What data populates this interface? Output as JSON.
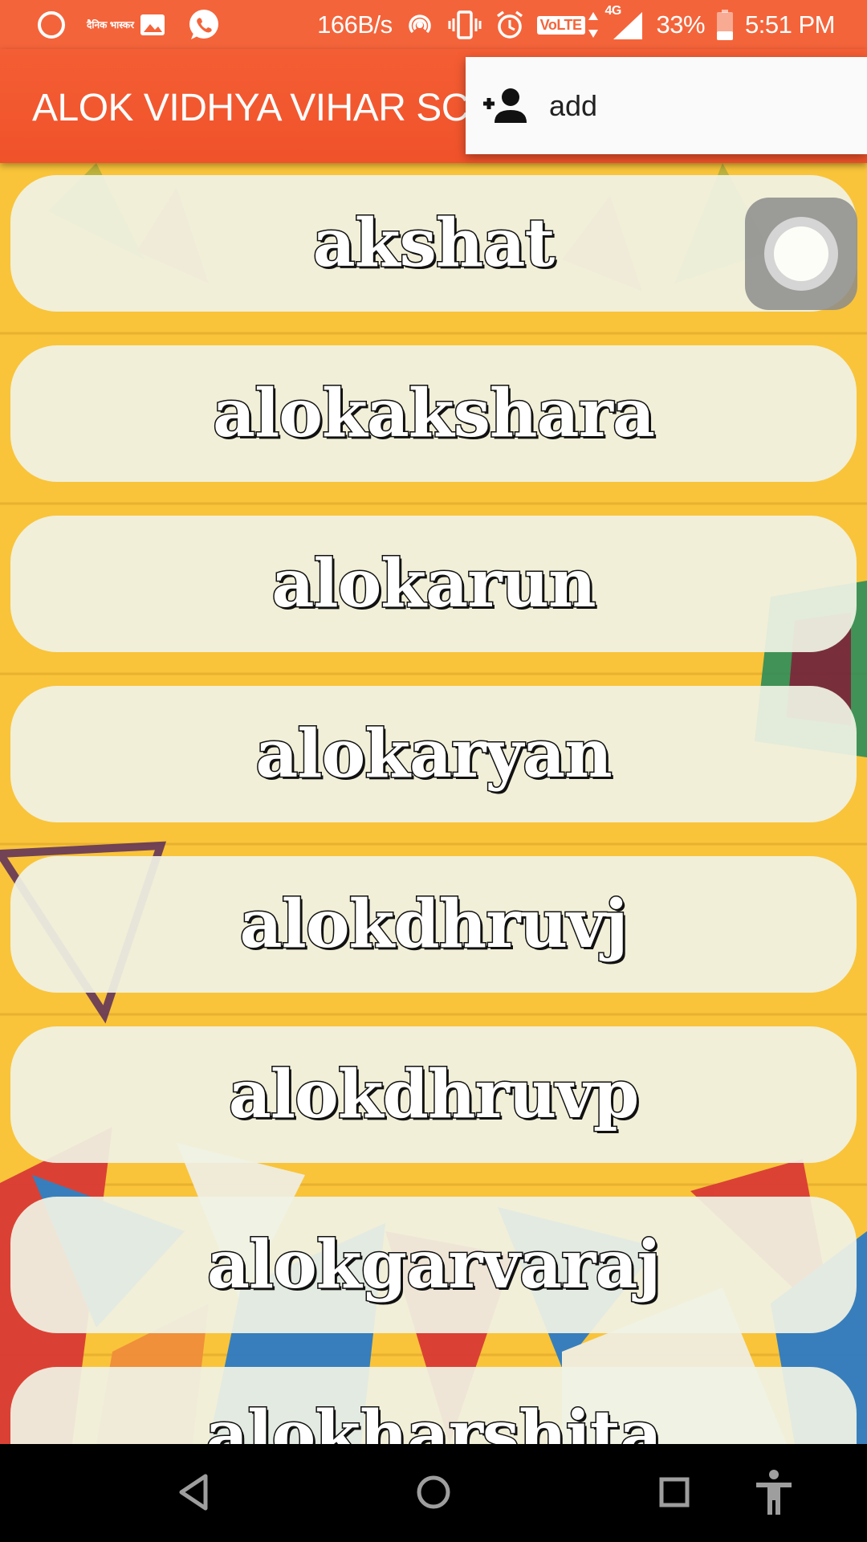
{
  "status_bar": {
    "network_speed": "166B/s",
    "volte": "VoLTE",
    "network_type": "4G",
    "battery": "33%",
    "time": "5:51 PM",
    "news_app_label": "दैनिक भास्कर",
    "icons": [
      "circle-notification-icon",
      "dainik-bhaskar-icon",
      "gallery-icon",
      "whatsapp-icon",
      "hotspot-icon",
      "vibrate-icon",
      "alarm-icon",
      "volte-icon",
      "signal-icon",
      "battery-icon"
    ],
    "color": "#f4643a"
  },
  "app_bar": {
    "title": "ALOK VIDHYA VIHAR SC",
    "color": "#f0522a"
  },
  "popup_menu": {
    "items": [
      {
        "label": "add",
        "icon": "person-add-icon"
      }
    ]
  },
  "list": {
    "items": [
      {
        "label": "akshat"
      },
      {
        "label": "alokakshara"
      },
      {
        "label": "alokarun"
      },
      {
        "label": "alokaryan"
      },
      {
        "label": "alokdhruvj"
      },
      {
        "label": "alokdhruvp"
      },
      {
        "label": "alokgarvaraj"
      },
      {
        "label": "alokharshita"
      }
    ]
  },
  "nav_bar": {
    "buttons": [
      "back-icon",
      "home-icon",
      "recents-icon",
      "accessibility-icon"
    ]
  },
  "colors": {
    "background": "#f9c43a",
    "item_background": "#f0f2e4"
  }
}
